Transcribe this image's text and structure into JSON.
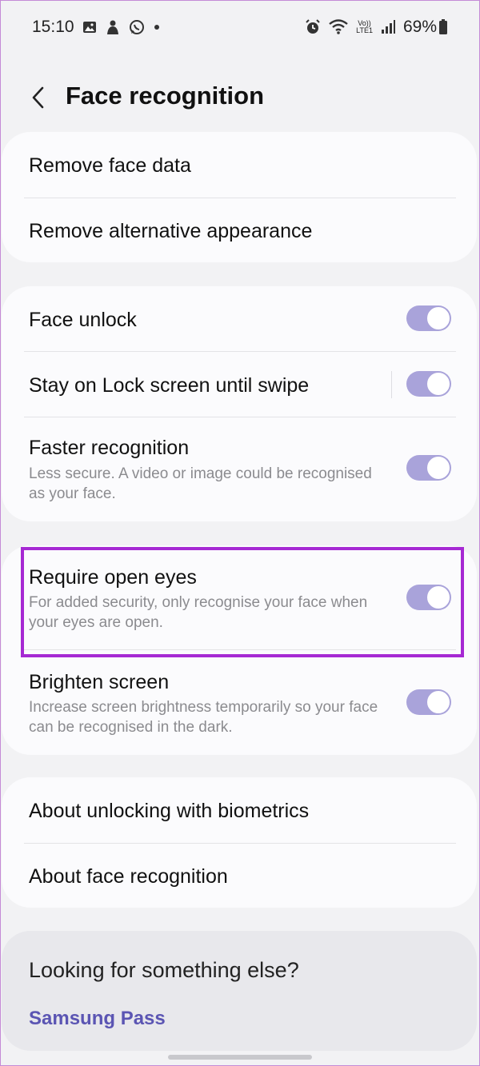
{
  "status_bar": {
    "time": "15:10",
    "battery": "69%",
    "volte_top": "Vo))",
    "volte_bottom": "LTE1",
    "left_icons": [
      "gallery-icon",
      "person-icon",
      "whatsapp-icon",
      "dot-icon"
    ],
    "right_icons": [
      "alarm-icon",
      "wifi-icon",
      "volte-icon",
      "signal-icon",
      "battery-icon"
    ]
  },
  "header": {
    "title": "Face recognition"
  },
  "group1": {
    "remove_face_data": "Remove face data",
    "remove_alternative": "Remove alternative appearance"
  },
  "group2": {
    "face_unlock": {
      "label": "Face unlock",
      "on": true
    },
    "stay_on_lock": {
      "label": "Stay on Lock screen until swipe",
      "on": true
    },
    "faster": {
      "label": "Faster recognition",
      "sub": "Less secure. A video or image could be recognised as your face.",
      "on": true
    }
  },
  "group3": {
    "require_open_eyes": {
      "label": "Require open eyes",
      "sub": "For added security, only recognise your face when your eyes are open.",
      "on": true
    },
    "brighten": {
      "label": "Brighten screen",
      "sub": "Increase screen brightness temporarily so your face can be recognised in the dark.",
      "on": true
    }
  },
  "group4": {
    "about_biometrics": "About unlocking with biometrics",
    "about_face": "About face recognition"
  },
  "looking": {
    "question": "Looking for something else?",
    "link": "Samsung Pass"
  },
  "colors": {
    "accent": "#5b55b3",
    "toggle_on": "#a9a3da",
    "highlight": "#a629d3"
  }
}
